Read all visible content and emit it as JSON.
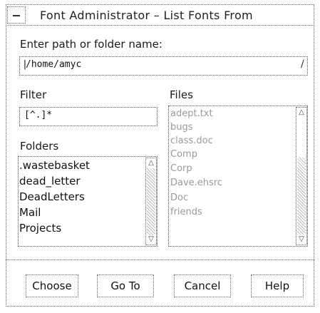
{
  "window": {
    "title": "Font Administrator – List Fonts From"
  },
  "path": {
    "label": "Enter path or folder name:",
    "value": "/home/amyc",
    "scroll_glyph": "/"
  },
  "filter": {
    "label": "Filter",
    "value": "[^.]*"
  },
  "folders": {
    "label": "Folders",
    "items": [
      ".wastebasket",
      "dead_letter",
      "DeadLetters",
      "Mail",
      "Projects"
    ]
  },
  "files": {
    "label": "Files",
    "items": [
      "adept.txt",
      "bugs",
      "class.doc",
      "Comp",
      "Corp",
      "Dave.ehsrc",
      "Doc",
      "friends"
    ]
  },
  "buttons": {
    "choose": "Choose",
    "goto": "Go To",
    "cancel": "Cancel",
    "help": "Help"
  }
}
